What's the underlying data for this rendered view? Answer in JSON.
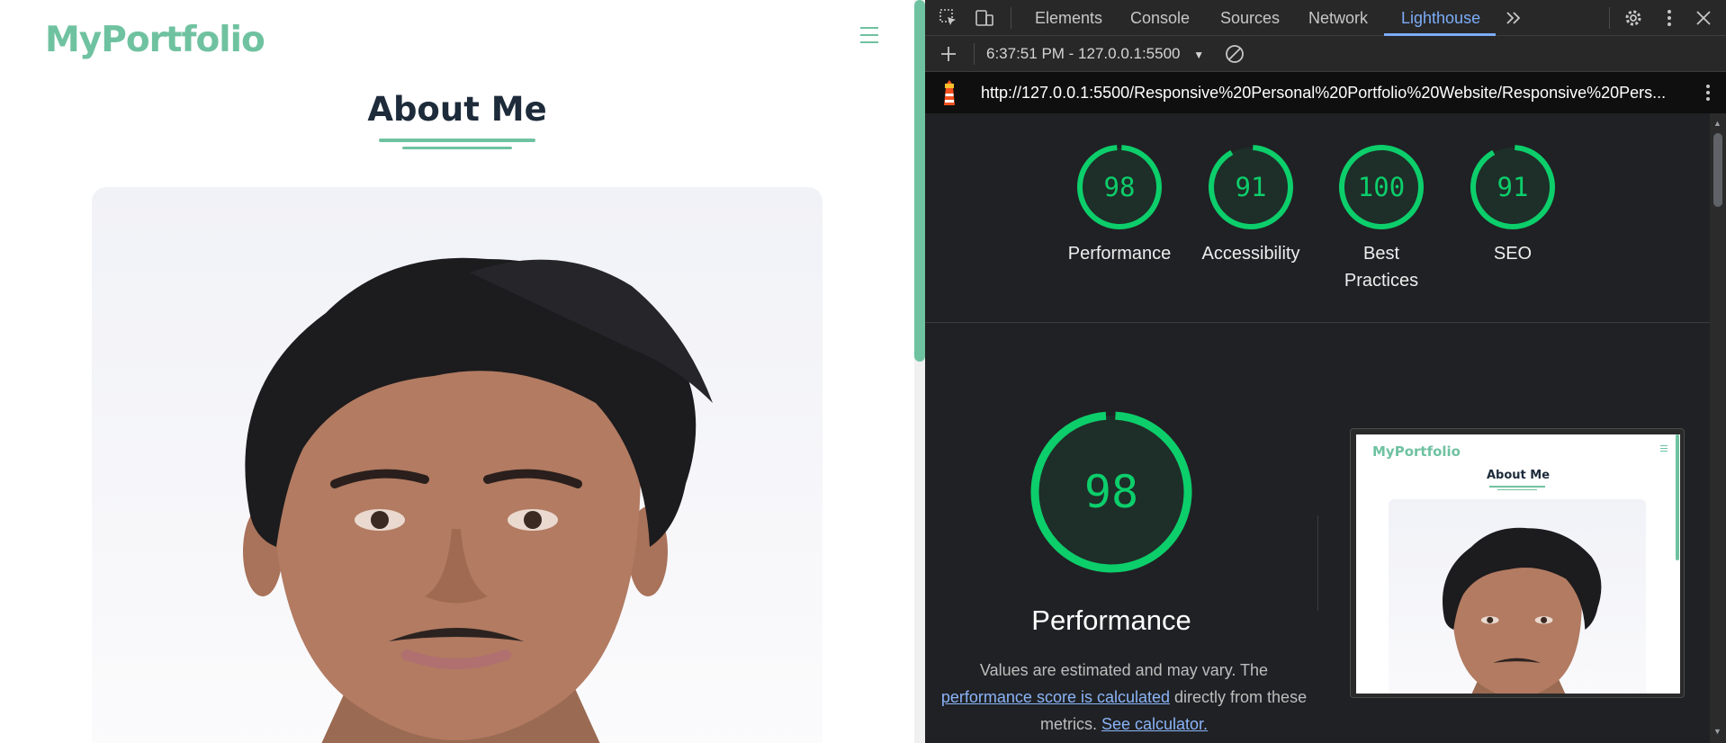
{
  "site": {
    "logo": "MyPortfolio",
    "section_title": "About Me",
    "photo_alt": "profile photo of a young man",
    "accent_color": "#6fc2a0",
    "menu_icon": "hamburger-menu-icon"
  },
  "devtools": {
    "toolbar_icons": [
      "inspect-element-icon",
      "device-toolbar-icon"
    ],
    "tabs": [
      "Elements",
      "Console",
      "Sources",
      "Network",
      "Lighthouse"
    ],
    "active_tab": "Lighthouse",
    "more_tabs_icon": "chevron-double-right-icon",
    "right_icons": [
      "settings-gear-icon",
      "kebab-menu-icon",
      "close-icon"
    ],
    "report_selector": "6:37:51 PM - 127.0.0.1:5500",
    "report_url": "http://127.0.0.1:5500/Responsive%20Personal%20Portfolio%20Website/Responsive%20Pers...",
    "scores": [
      {
        "value": 98,
        "label": "Performance"
      },
      {
        "value": 91,
        "label": "Accessibility"
      },
      {
        "value": 100,
        "label": "Best Practices",
        "label_lines": [
          "Best",
          "Practices"
        ]
      },
      {
        "value": 91,
        "label": "SEO"
      }
    ],
    "pass_color": "#0cce6b",
    "performance": {
      "score": 98,
      "title": "Performance",
      "desc_prefix": "Values are estimated and may vary. The",
      "desc_link": "performance score is calculated",
      "desc_middle": "directly from these",
      "desc_end": "metrics.",
      "calc_link": "See calculator."
    },
    "thumbnail": {
      "logo": "MyPortfolio",
      "title": "About Me"
    }
  }
}
